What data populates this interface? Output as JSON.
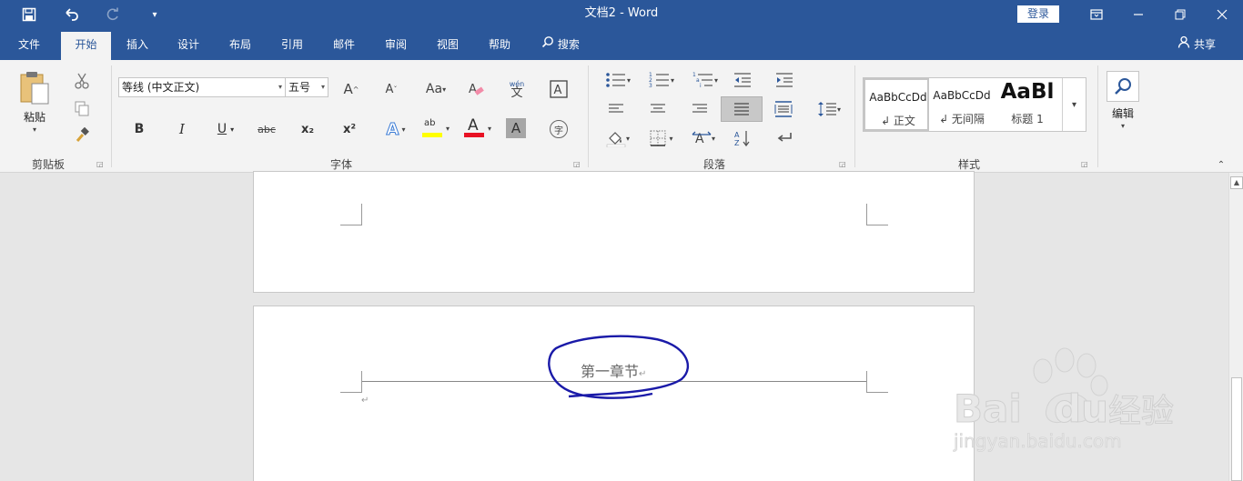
{
  "window": {
    "title": "文档2  -  Word",
    "login_label": "登录"
  },
  "quick_access": {
    "save_icon": "save-icon",
    "undo_icon": "undo-icon",
    "redo_icon": "redo-icon",
    "customize_icon": "customize-qat-icon"
  },
  "tabs": {
    "file": "文件",
    "home": "开始",
    "insert": "插入",
    "design": "设计",
    "layout": "布局",
    "references": "引用",
    "mailings": "邮件",
    "review": "审阅",
    "view": "视图",
    "help": "帮助",
    "search": "搜索",
    "share": "共享"
  },
  "ribbon": {
    "clipboard": {
      "label": "剪贴板",
      "paste": "粘贴"
    },
    "font": {
      "label": "字体",
      "font_name": "等线 (中文正文)",
      "font_size": "五号",
      "grow": "A",
      "shrink": "A",
      "change_case": "Aa",
      "phonetic": "wén",
      "phonetic_char": "文",
      "bold": "B",
      "italic": "I",
      "underline": "U",
      "strike": "abc",
      "subscript": "x₂",
      "superscript": "x²",
      "text_effect": "A",
      "highlight": "ab",
      "font_color": "A",
      "char_shading": "A",
      "enclose": "字",
      "highlight_color": "#ffff00",
      "font_color_value": "#e81123"
    },
    "paragraph": {
      "label": "段落"
    },
    "styles": {
      "label": "样式",
      "items": [
        {
          "sample": "AaBbCcDd",
          "name": "↲ 正文"
        },
        {
          "sample": "AaBbCcDd",
          "name": "↲ 无间隔"
        },
        {
          "sample": "AaBl",
          "name": "标题 1"
        }
      ]
    },
    "editing": {
      "label": "编辑"
    }
  },
  "document": {
    "header_text": "第一章节",
    "paragraph_mark": "↵",
    "annotation_color": "#1a1aa8"
  },
  "watermark": {
    "brand": "Bai",
    "brand2": "du",
    "cn": "经验",
    "url": "jingyan.baidu.com"
  }
}
